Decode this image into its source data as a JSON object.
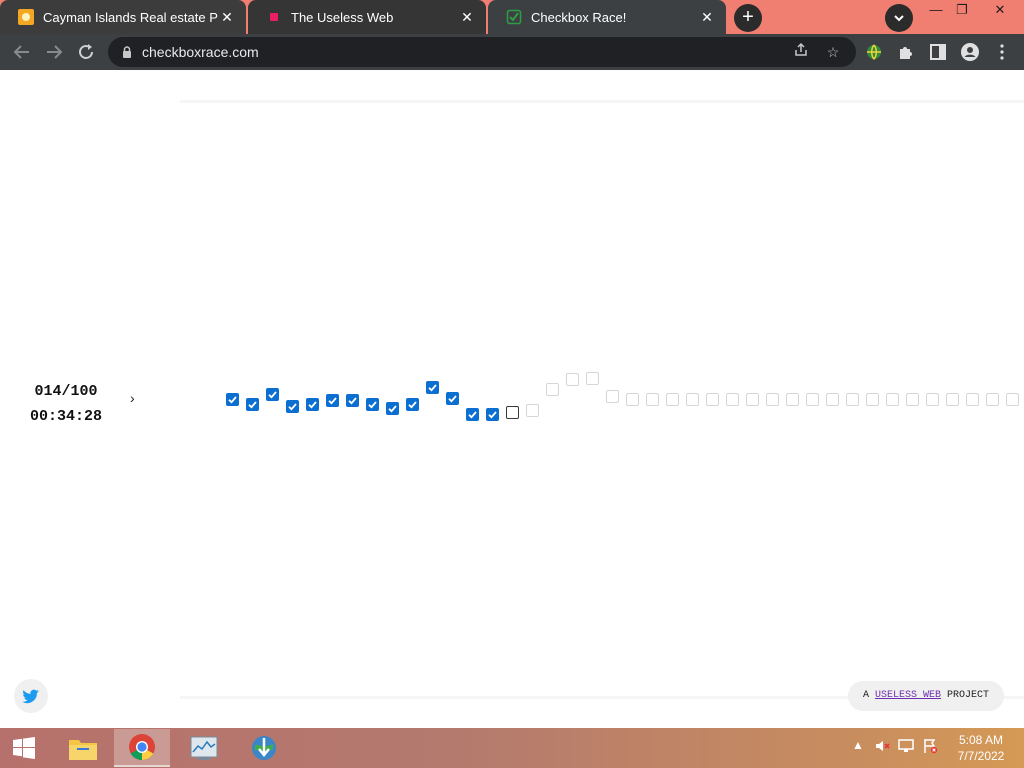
{
  "browser": {
    "tabs": [
      {
        "title": "Cayman Islands Real estate Prope",
        "favicon": "sun-icon"
      },
      {
        "title": "The Useless Web",
        "favicon": "pink-square-icon"
      },
      {
        "title": "Checkbox Race!",
        "favicon": "green-check-icon"
      }
    ],
    "active_tab": 2,
    "url": "checkboxrace.com",
    "window_controls": {
      "minimize": "—",
      "restore": "❐",
      "close": "✕"
    }
  },
  "page": {
    "counter": "014/100",
    "timer": "00:34:28",
    "arrow": "›",
    "checkboxes_shown": {
      "checked": 14,
      "unchecked_active": 1,
      "faded": 25
    },
    "credit": {
      "prefix": "A",
      "link": "USELESS WEB",
      "suffix": "PROJECT"
    }
  },
  "taskbar": {
    "apps": [
      "windows-start-icon",
      "file-explorer-icon",
      "chrome-icon",
      "task-manager-icon",
      "internet-download-manager-icon"
    ],
    "active_app": "chrome-icon",
    "clock_time": "5:08 AM",
    "clock_date": "7/7/2022"
  },
  "colors": {
    "tab_strip": "#f07f72",
    "toolbar": "#3c4043",
    "checkbox_checked": "#0b6fd1",
    "credit_link": "#6a2fb0"
  }
}
